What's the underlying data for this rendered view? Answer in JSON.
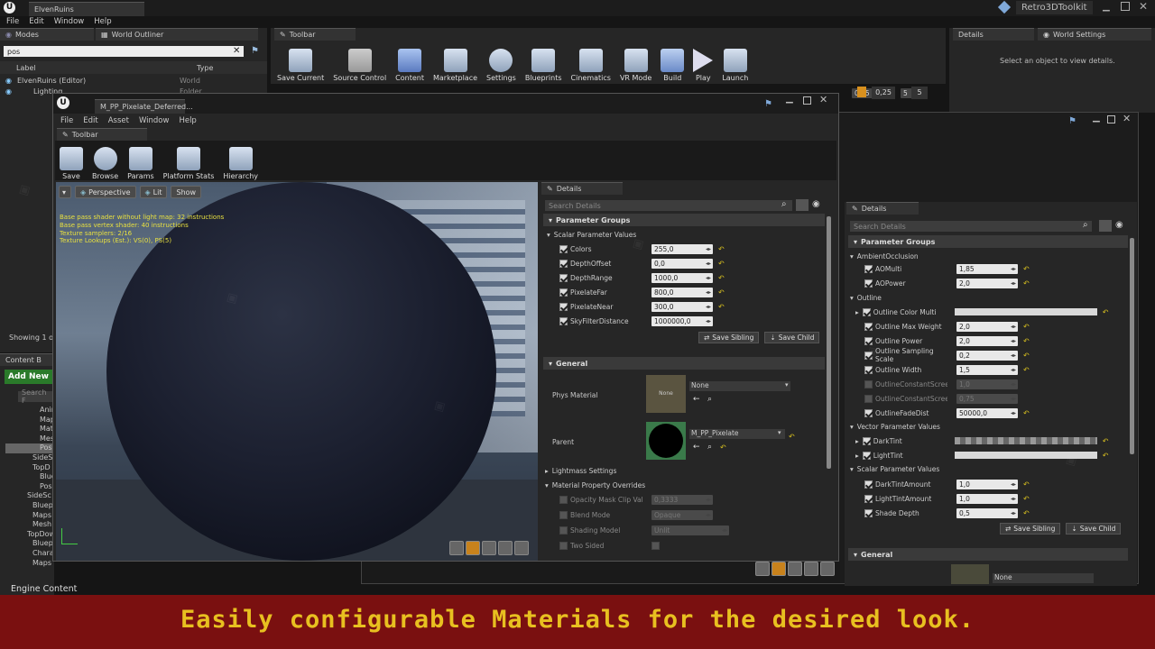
{
  "editor": {
    "project_tab": "ElvenRuins",
    "menu": [
      "File",
      "Edit",
      "Window",
      "Help"
    ],
    "top_right_badge": "Retro3DToolkit",
    "tabs": {
      "modes": "Modes",
      "outliner": "World Outliner",
      "toolbar": "Toolbar",
      "details": "Details",
      "world_settings": "World Settings"
    },
    "toolbar_buttons": [
      "Save Current",
      "Source Control",
      "Content",
      "Marketplace",
      "Settings",
      "Blueprints",
      "Cinematics",
      "VR Mode",
      "Build",
      "Play",
      "Launch"
    ],
    "outliner": {
      "search_value": "pos",
      "col_label": "Label",
      "col_type": "Type",
      "rows": [
        {
          "label": "ElvenRuins (Editor)",
          "type": "World"
        },
        {
          "label": "Lighting",
          "type": "Folder"
        }
      ],
      "showing": "Showing 1 of"
    },
    "details_empty": "Select an object to view details.",
    "numfields": [
      "0,25",
      "5"
    ],
    "content_browser": {
      "tab": "Content B",
      "add_new": "Add New",
      "search": "Search F",
      "tree": [
        "Anim",
        "Map",
        "Mat",
        "Mes",
        "Pos",
        "SideS",
        "TopD",
        "Blue",
        "Pos",
        "SideSc",
        "Bluep",
        "Maps",
        "Mesh",
        "TopDow",
        "Bluep",
        "Character",
        "Maps"
      ],
      "engine": "Engine Content"
    }
  },
  "material_editor": {
    "title": "M_PP_Pixelate_Deferred...",
    "menu": [
      "File",
      "Edit",
      "Asset",
      "Window",
      "Help"
    ],
    "toolbar_tab": "Toolbar",
    "toolbar_buttons": [
      "Save",
      "Browse",
      "Params",
      "Platform Stats",
      "Hierarchy"
    ],
    "viewport": {
      "buttons": [
        "Perspective",
        "Lit",
        "Show"
      ],
      "stats": [
        "Base pass shader without light map: 32 instructions",
        "Base pass vertex shader: 40 instructions",
        "Texture samplers: 2/16",
        "Texture Lookups (Est.): VS(0), PS(5)"
      ]
    },
    "details": {
      "tab": "Details",
      "search": "Search Details",
      "parameter_groups": "Parameter Groups",
      "scalar_header": "Scalar Parameter Values",
      "params": [
        {
          "name": "Colors",
          "value": "255,0"
        },
        {
          "name": "DepthOffset",
          "value": "0,0"
        },
        {
          "name": "DepthRange",
          "value": "1000,0"
        },
        {
          "name": "PixelateFar",
          "value": "800,0"
        },
        {
          "name": "PixelateNear",
          "value": "300,0"
        },
        {
          "name": "SkyFilterDistance",
          "value": "1000000,0"
        }
      ],
      "save_sibling": "Save Sibling",
      "save_child": "Save Child",
      "general": "General",
      "phys_material": "Phys Material",
      "phys_value": "None",
      "thumb_none": "None",
      "parent": "Parent",
      "parent_value": "M_PP_Pixelate",
      "lightmass": "Lightmass Settings",
      "overrides": "Material Property Overrides",
      "override_rows": [
        {
          "name": "Opacity Mask Clip Value",
          "value": "0,3333"
        },
        {
          "name": "Blend Mode",
          "value": "Opaque"
        },
        {
          "name": "Shading Model",
          "value": "Unlit"
        },
        {
          "name": "Two Sided",
          "value": ""
        }
      ]
    }
  },
  "right_details": {
    "tab": "Details",
    "search": "Search Details",
    "parameter_groups": "Parameter Groups",
    "ao_header": "AmbientOcclusion",
    "ao": [
      {
        "name": "AOMulti",
        "value": "1,85"
      },
      {
        "name": "AOPower",
        "value": "2,0"
      }
    ],
    "outline_header": "Outline",
    "outline": [
      {
        "name": "Outline Color Multi",
        "value": "",
        "type": "color"
      },
      {
        "name": "Outline Max Weight",
        "value": "2,0"
      },
      {
        "name": "Outline Power",
        "value": "2,0"
      },
      {
        "name": "Outline Sampling Scale",
        "value": "0,2"
      },
      {
        "name": "Outline Width",
        "value": "1,5"
      },
      {
        "name": "OutlineConstantScreen",
        "value": "1,0",
        "disabled": true
      },
      {
        "name": "OutlineConstantScreen",
        "value": "0,75",
        "disabled": true
      },
      {
        "name": "OutlineFadeDist",
        "value": "50000,0"
      }
    ],
    "vector_header": "Vector Parameter Values",
    "vectors": [
      "DarkTint",
      "LightTint"
    ],
    "scalar_header": "Scalar Parameter Values",
    "scalars": [
      {
        "name": "DarkTintAmount",
        "value": "1,0"
      },
      {
        "name": "LightTintAmount",
        "value": "1,0"
      },
      {
        "name": "Shade Depth",
        "value": "0,5"
      }
    ],
    "save_sibling": "Save Sibling",
    "save_child": "Save Child",
    "general": "General",
    "general_value": "None"
  },
  "banner": {
    "text": "Easily configurable Materials for the desired look.",
    "bg": "#7a1010",
    "fg": "#e8c020"
  }
}
